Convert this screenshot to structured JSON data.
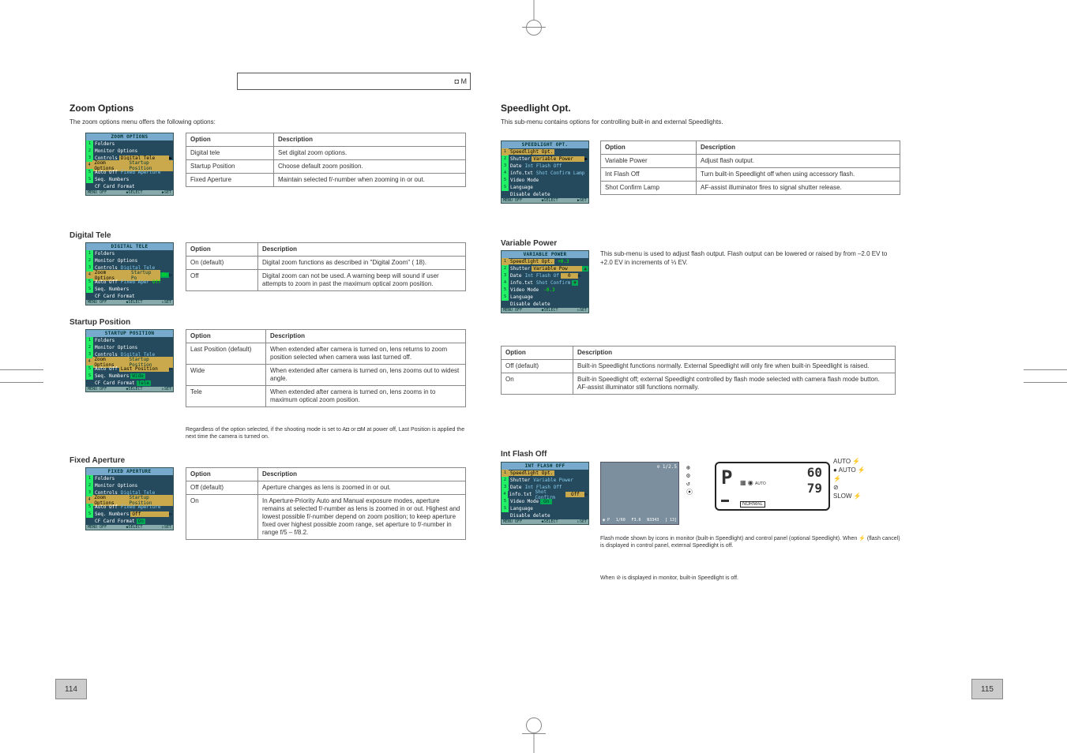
{
  "header": {
    "mode_icons": "◘ M"
  },
  "left_page": {
    "title": "Zoom Options",
    "page_num": "114",
    "intro": "The zoom options menu offers the following options:",
    "table1": [
      [
        "Option",
        "Description"
      ],
      [
        "Digital tele",
        "Set digital zoom options."
      ],
      [
        "Startup Position",
        "Choose default zoom position."
      ],
      [
        "Fixed Aperture",
        "Maintain selected f/-number when zooming in or out."
      ]
    ],
    "lcd1": {
      "title": "ZOOM OPTIONS",
      "items": [
        "Folders",
        "Monitor Options",
        "Controls",
        "Zoom Options",
        "Auto Off",
        "Seq. Numbers",
        "CF Card Format"
      ],
      "sub": [
        "Digital Tele",
        "Startup Position",
        "Fixed Aperture"
      ],
      "highlight": "Digital Tele",
      "footer": [
        "MENU OFF",
        "◆SELECT",
        "▶SET"
      ]
    },
    "digital_tele": {
      "heading": "Digital Tele",
      "table": [
        [
          "Option",
          "Description"
        ],
        [
          "On (default)",
          "Digital zoom functions as described in \"Digital Zoom\" ( 18)."
        ],
        [
          "Off",
          "Digital zoom can not be used. A warning beep will sound if user attempts to zoom in past the maximum optical zoom position."
        ]
      ],
      "lcd": {
        "title": "DIGITAL TELE",
        "items": [
          "Folders",
          "Monitor Options",
          "Controls",
          "Zoom Options",
          "Auto Off",
          "Seq. Numbers",
          "CF Card Format"
        ],
        "sub": [
          "Digital Tele",
          "Startup Po",
          "Fixed Aper"
        ],
        "vals": [
          "On",
          "Off"
        ],
        "footer": [
          "MENU OFF",
          "◆SELECT",
          "▷SET"
        ]
      }
    },
    "startup": {
      "heading": "Startup Position",
      "table": [
        [
          "Option",
          "Description"
        ],
        [
          "Last Position (default)",
          "When extended after camera is turned on, lens returns to zoom position selected when camera was last turned off."
        ],
        [
          "Wide",
          "When extended after camera is turned on, lens zooms out to widest angle."
        ],
        [
          "Tele",
          "When extended after camera is turned on, lens zooms in to maximum optical zoom position."
        ]
      ],
      "footnote": "Regardless of the option selected, if the shooting mode is set to A◘ or ◘M at power off, Last Position is applied the next time the camera is turned on.",
      "lcd": {
        "title": "STARTUP POSITION",
        "items": [
          "Folders",
          "Monitor Options",
          "Controls",
          "Zoom Options",
          "Auto Off",
          "Seq. Numbers",
          "CF Card Format"
        ],
        "sub": [
          "Digital Tele",
          "Startup Position",
          "Last Position",
          "Wide",
          "Tele"
        ],
        "footer": [
          "MENU OFF",
          "◆SELECT",
          "▷SET"
        ]
      }
    },
    "aperture": {
      "heading": "Fixed Aperture",
      "table": [
        [
          "Option",
          "Description"
        ],
        [
          "Off (default)",
          "Aperture changes as lens is zoomed in or out."
        ],
        [
          "On",
          "In Aperture-Priority Auto and Manual exposure modes, aperture remains at selected f/-number as lens is zoomed in or out. Highest and lowest possible f/-number depend on zoom position; to keep aperture fixed over highest possible zoom range, set aperture to f/-number in range f/5 – f/8.2."
        ]
      ],
      "lcd": {
        "title": "FIXED APERTURE",
        "items": [
          "Folders",
          "Monitor Options",
          "Controls",
          "Zoom Options",
          "Auto Off",
          "Seq. Numbers",
          "CF Card Format"
        ],
        "sub": [
          "Digital Tele",
          "Startup Position",
          "Fixed Aperture"
        ],
        "vals": [
          "Off",
          "On"
        ],
        "footer": [
          "MENU OFF",
          "◆SELECT",
          "▷SET"
        ]
      }
    }
  },
  "right_page": {
    "title": "Speedlight Opt.",
    "page_num": "115",
    "intro": "This sub-menu contains options for controlling built-in and external Speedlights.",
    "table1": [
      [
        "Option",
        "Description"
      ],
      [
        "Variable Power",
        "Adjust flash output."
      ],
      [
        "Int Flash Off",
        "Turn built-in Speedlight off when using accessory flash."
      ],
      [
        "Shot Confirm Lamp",
        "AF-assist illuminator fires to signal shutter release."
      ]
    ],
    "lcd1": {
      "title": "SPEEDLIGHT OPT.",
      "items": [
        "Speedlight Opt.",
        "Shutter",
        "Date",
        "info.txt",
        "Video Mode",
        "Language",
        "Disable delete"
      ],
      "sub": [
        "Variable Power",
        "Int Flash Off",
        "Shot Confirm Lamp"
      ],
      "footer": [
        "MENU OFF",
        "◆SELECT",
        "▶SET"
      ]
    },
    "variable_power": {
      "heading": "Variable Power",
      "body": "This sub-menu is used to adjust flash output. Flash output can be lowered or raised by from –2.0 EV to +2.0 EV in increments of ⅓ EV.",
      "lcd": {
        "title": "VARIABLE POWER",
        "items": [
          "Speedlight Opt.",
          "Shutter",
          "Date",
          "info.txt",
          "Video Mode",
          "Language",
          "Disable delete"
        ],
        "sub": [
          "Variable Pow",
          "Int Flash Of",
          "Shot Confirm"
        ],
        "scale": [
          "+0.3",
          "▲",
          "0",
          "▷",
          "▼",
          "-0.3"
        ],
        "footer": [
          "MENU OFF",
          "◆SELECT",
          "▷SET"
        ]
      }
    },
    "int_flash": {
      "heading": "Int Flash Off",
      "table": [
        [
          "Option",
          "Description"
        ],
        [
          "Off (default)",
          "Built-in Speedlight functions normally. External Speedlight will only fire when built-in Speedlight is raised."
        ],
        [
          "On",
          "Built-in Speedlight off; external Speedlight controlled by flash mode selected with camera flash mode button. AF-assist illuminator still functions normally."
        ]
      ],
      "disp_caption1": "Flash mode shown by icons in monitor (built-in Speedlight) and control panel (optional Speedlight). When ⚡ (flash cancel) is displayed in control panel, external Speedlight is off.",
      "disp_caption2": "When ⊘ is displayed in monitor, built-in Speedlight is off.",
      "lcd": {
        "title": "INT FLASH OFF",
        "items": [
          "Speedlight Opt.",
          "Shutter",
          "Date",
          "info.txt",
          "Video Mode",
          "Language",
          "Disable delete"
        ],
        "sub": [
          "Variable Power",
          "Int Flash Off",
          "Shot Confirm"
        ],
        "vals": [
          "Off",
          "On"
        ],
        "footer": [
          "MENU OFF",
          "◆SELECT",
          "▷SET"
        ]
      },
      "monitor": {
        "top": "⊘ 1/2.5",
        "left_icons": [
          "⊛",
          "⚙",
          "↺",
          "⦿"
        ],
        "bottom": [
          "◉ P",
          "1/60",
          "F3.6",
          "N3343",
          "[  13]"
        ]
      },
      "panel": {
        "big": "P",
        "seg1": "60",
        "seg2": "79",
        "right_small": "AUTO",
        "bottom": "NORMAL",
        "right_col": [
          "AUTO ⚡",
          "● AUTO ⚡",
          "⚡",
          "⊘",
          "SLOW ⚡"
        ]
      }
    }
  }
}
